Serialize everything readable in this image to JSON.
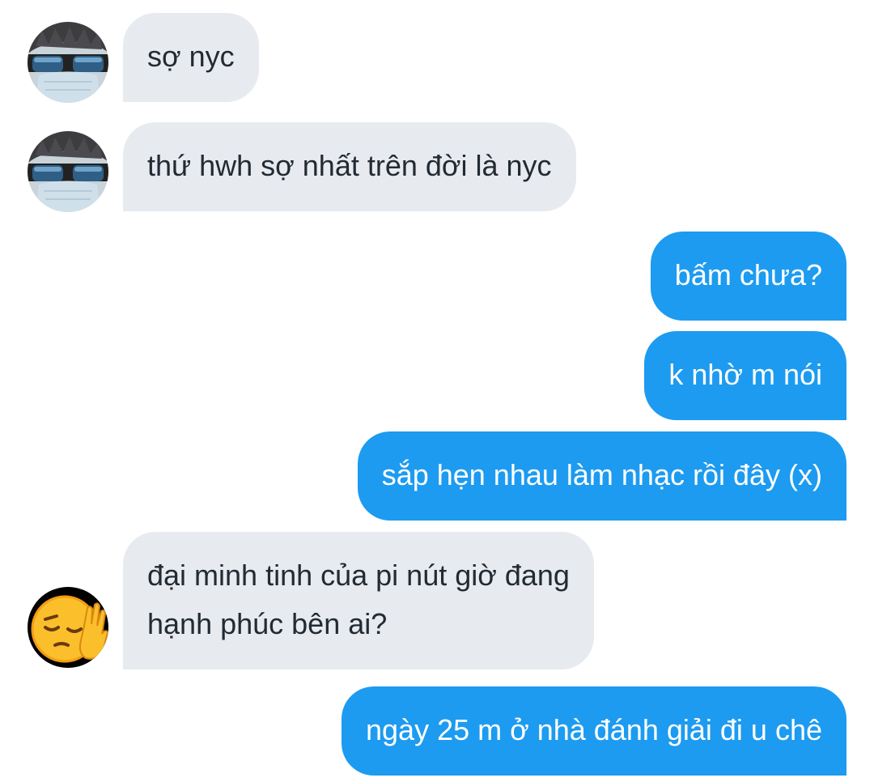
{
  "conversation": {
    "messages": [
      {
        "direction": "in",
        "avatar": "sunglasses-mask-person",
        "lines": [
          "sợ nyc"
        ]
      },
      {
        "direction": "in",
        "avatar": "sunglasses-mask-person",
        "lines": [
          "thứ hwh sợ nhất trên đời là nyc"
        ]
      },
      {
        "direction": "out",
        "lines": [
          "bấm chưa?"
        ]
      },
      {
        "direction": "out",
        "lines": [
          "k nhờ m nói"
        ]
      },
      {
        "direction": "out",
        "lines": [
          "sắp hẹn nhau làm nhạc rồi đây (x)"
        ]
      },
      {
        "direction": "in",
        "avatar": "pensive-face-emoji",
        "lines": [
          "đại minh tinh của pi nút giờ đang",
          "hạnh phúc bên ai?"
        ]
      },
      {
        "direction": "out",
        "lines": [
          "ngày 25 m ở nhà đánh giải đi u chê"
        ]
      }
    ]
  },
  "colors": {
    "incoming_bubble": "#e7ebef",
    "outgoing_bubble": "#1d9bf0",
    "incoming_text": "#222a33",
    "outgoing_text": "#ffffff"
  }
}
